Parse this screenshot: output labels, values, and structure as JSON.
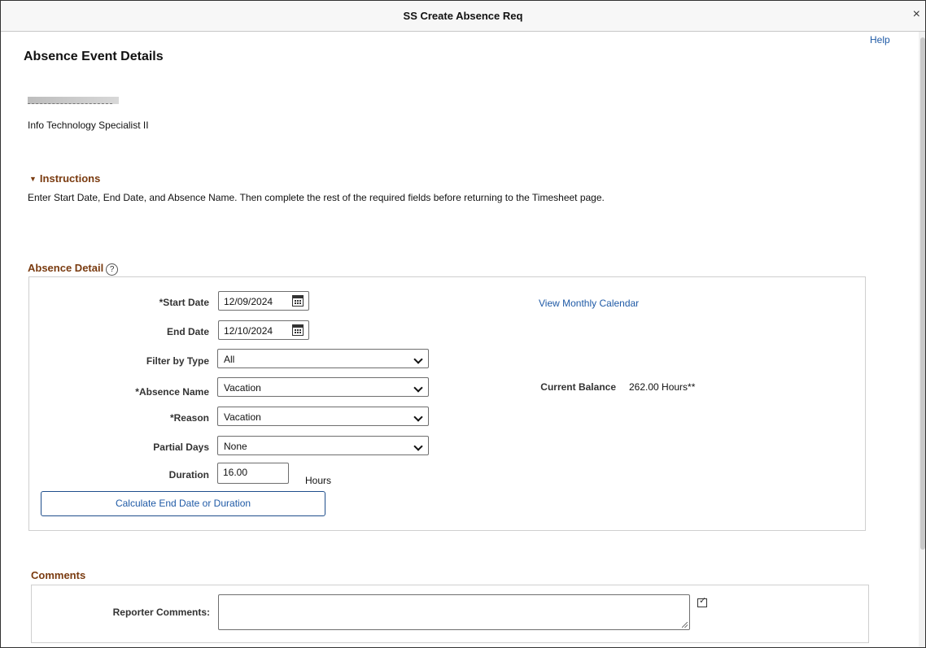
{
  "window": {
    "title": "SS Create Absence Req",
    "close_glyph": "×"
  },
  "help_link": "Help",
  "page_title": "Absence Event Details",
  "employee": {
    "job_title": "Info Technology Specialist II"
  },
  "instructions": {
    "toggle_glyph": "▼",
    "heading": "Instructions",
    "text": "Enter Start Date, End Date, and Absence Name. Then complete the rest of the required fields before returning to the Timesheet page."
  },
  "absence_detail": {
    "heading": "Absence Detail",
    "help_glyph": "?",
    "start_date_label": "*Start Date",
    "start_date_value": "12/09/2024",
    "end_date_label": "End Date",
    "end_date_value": "12/10/2024",
    "view_calendar_link": "View Monthly Calendar",
    "filter_label": "Filter by Type",
    "filter_value": "All",
    "absence_name_label": "*Absence Name",
    "absence_name_value": "Vacation",
    "current_balance_label": "Current Balance",
    "current_balance_value": "262.00 Hours**",
    "reason_label": "*Reason",
    "reason_value": "Vacation",
    "partial_days_label": "Partial Days",
    "partial_days_value": "None",
    "duration_label": "Duration",
    "duration_value": "16.00",
    "duration_unit": "Hours",
    "calculate_button": "Calculate End Date or Duration"
  },
  "comments": {
    "heading": "Comments",
    "reporter_label": "Reporter Comments:"
  }
}
